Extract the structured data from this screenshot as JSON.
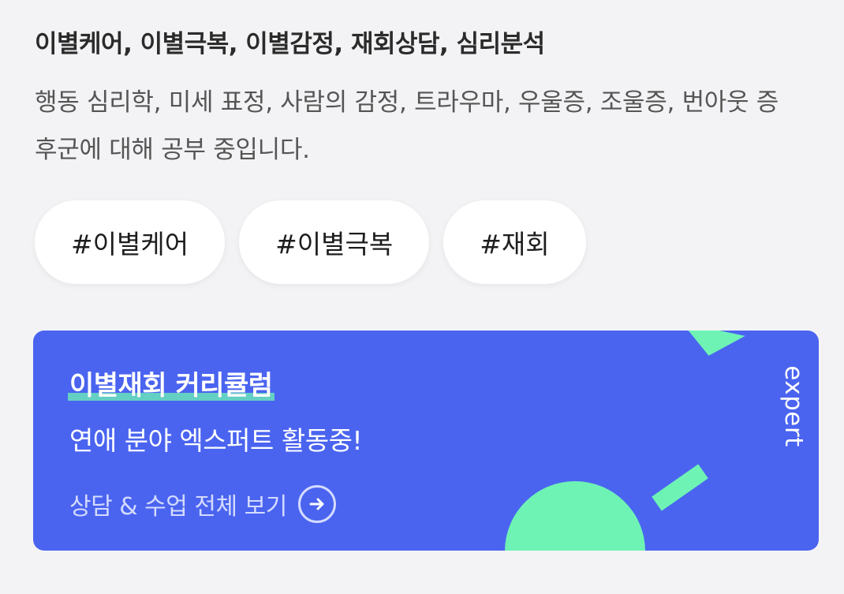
{
  "profile": {
    "keywords": "이별케어, 이별극복, 이별감정, 재회상담, 심리분석",
    "description": "행동 심리학, 미세 표정, 사람의 감정, 트라우마, 우울증, 조울증, 번아웃 증후군에 대해 공부 중입니다."
  },
  "tags": [
    {
      "label": "#이별케어"
    },
    {
      "label": "#이별극복"
    },
    {
      "label": "#재회"
    }
  ],
  "banner": {
    "title": "이별재회 커리큘럼",
    "subtitle": "연애 분야 엑스퍼트 활동중!",
    "link_label": "상담 & 수업 전체 보기",
    "logo_text": "expert",
    "link_icon": "arrow-right-icon",
    "colors": {
      "background": "#4a64f0",
      "accent": "#6ef3b4",
      "link": "#d4dbff"
    }
  }
}
